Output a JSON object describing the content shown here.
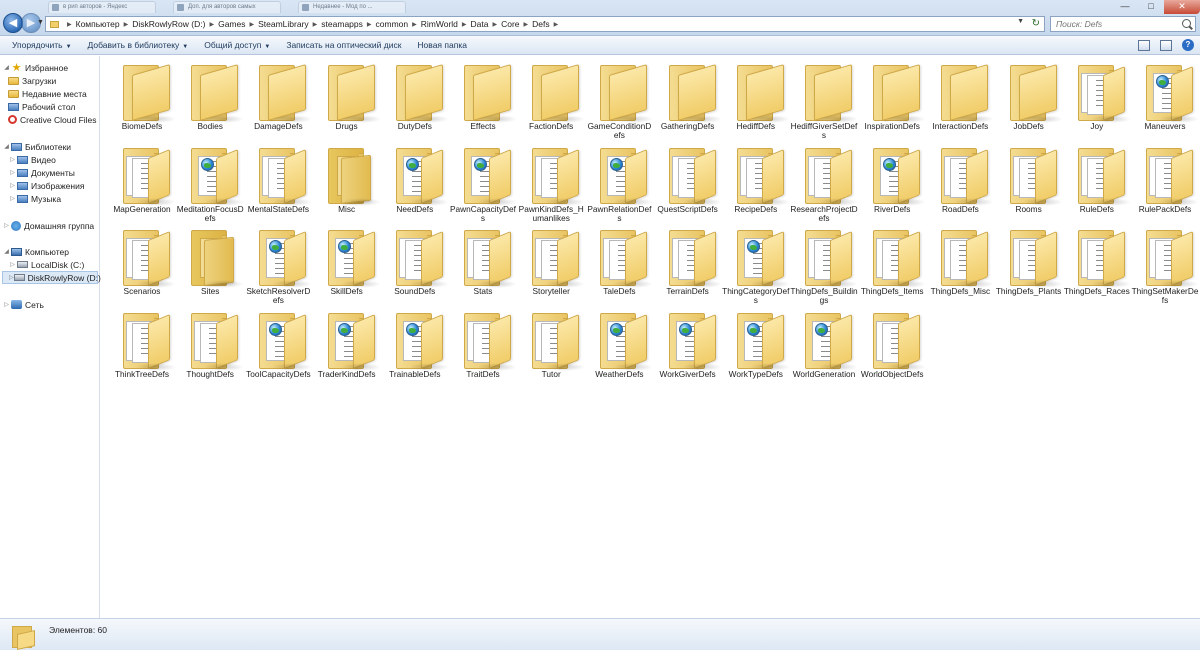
{
  "tabs": [
    {
      "label": "в рип авторов - Яндекс"
    },
    {
      "label": "Доп. для авторов самых"
    },
    {
      "label": "Недавнее - Мод по ..."
    }
  ],
  "breadcrumbs": [
    "Компьютер",
    "DiskRowlyRow (D:)",
    "Games",
    "SteamLibrary",
    "steamapps",
    "common",
    "RimWorld",
    "Data",
    "Core",
    "Defs"
  ],
  "search": {
    "placeholder": "Поиск: Defs"
  },
  "commands": [
    "Упорядочить",
    "Добавить в библиотеку",
    "Общий доступ",
    "Записать на оптический диск",
    "Новая папка"
  ],
  "nav": {
    "favorites": "Избранное",
    "downloads": "Загрузки",
    "recent": "Недавние места",
    "desktop": "Рабочий стол",
    "creative": "Creative Cloud Files",
    "libraries": "Библиотеки",
    "video": "Видео",
    "documents": "Документы",
    "images": "Изображения",
    "music": "Музыка",
    "homegroup": "Домашняя группа",
    "computer": "Компьютер",
    "localc": "LocalDisk (C:)",
    "diskd": "DiskRowlyRow (D:)",
    "network": "Сеть"
  },
  "folders": [
    {
      "name": "BiomeDefs",
      "icon": "empty"
    },
    {
      "name": "Bodies",
      "icon": "empty"
    },
    {
      "name": "DamageDefs",
      "icon": "empty"
    },
    {
      "name": "Drugs",
      "icon": "empty"
    },
    {
      "name": "DutyDefs",
      "icon": "empty"
    },
    {
      "name": "Effects",
      "icon": "empty"
    },
    {
      "name": "FactionDefs",
      "icon": "empty"
    },
    {
      "name": "GameConditionDefs",
      "icon": "empty"
    },
    {
      "name": "GatheringDefs",
      "icon": "empty"
    },
    {
      "name": "HediffDefs",
      "icon": "empty"
    },
    {
      "name": "HediffGiverSetDefs",
      "icon": "empty"
    },
    {
      "name": "InspirationDefs",
      "icon": "empty"
    },
    {
      "name": "InteractionDefs",
      "icon": "empty"
    },
    {
      "name": "JobDefs",
      "icon": "empty"
    },
    {
      "name": "Joy",
      "icon": "papers"
    },
    {
      "name": "Maneuvers",
      "icon": "globe"
    },
    {
      "name": "MapGeneration",
      "icon": "papers"
    },
    {
      "name": "MeditationFocusDefs",
      "icon": "globe"
    },
    {
      "name": "MentalStateDefs",
      "icon": "papers"
    },
    {
      "name": "Misc",
      "icon": "misc"
    },
    {
      "name": "NeedDefs",
      "icon": "globe"
    },
    {
      "name": "PawnCapacityDefs",
      "icon": "globe"
    },
    {
      "name": "PawnKindDefs_Humanlikes",
      "icon": "papers"
    },
    {
      "name": "PawnRelationDefs",
      "icon": "globe"
    },
    {
      "name": "QuestScriptDefs",
      "icon": "papers"
    },
    {
      "name": "RecipeDefs",
      "icon": "papers"
    },
    {
      "name": "ResearchProjectDefs",
      "icon": "papers"
    },
    {
      "name": "RiverDefs",
      "icon": "globe"
    },
    {
      "name": "RoadDefs",
      "icon": "papers"
    },
    {
      "name": "Rooms",
      "icon": "papers"
    },
    {
      "name": "RuleDefs",
      "icon": "papers"
    },
    {
      "name": "RulePackDefs",
      "icon": "papers"
    },
    {
      "name": "Scenarios",
      "icon": "papers"
    },
    {
      "name": "Sites",
      "icon": "misc"
    },
    {
      "name": "SketchResolverDefs",
      "icon": "globe"
    },
    {
      "name": "SkillDefs",
      "icon": "globe"
    },
    {
      "name": "SoundDefs",
      "icon": "papers"
    },
    {
      "name": "Stats",
      "icon": "papers"
    },
    {
      "name": "Storyteller",
      "icon": "papers"
    },
    {
      "name": "TaleDefs",
      "icon": "papers"
    },
    {
      "name": "TerrainDefs",
      "icon": "papers"
    },
    {
      "name": "ThingCategoryDefs",
      "icon": "globe"
    },
    {
      "name": "ThingDefs_Buildings",
      "icon": "papers"
    },
    {
      "name": "ThingDefs_Items",
      "icon": "papers"
    },
    {
      "name": "ThingDefs_Misc",
      "icon": "papers"
    },
    {
      "name": "ThingDefs_Plants",
      "icon": "papers"
    },
    {
      "name": "ThingDefs_Races",
      "icon": "papers"
    },
    {
      "name": "ThingSetMakerDefs",
      "icon": "papers"
    },
    {
      "name": "ThinkTreeDefs",
      "icon": "papers"
    },
    {
      "name": "ThoughtDefs",
      "icon": "papers"
    },
    {
      "name": "ToolCapacityDefs",
      "icon": "globe"
    },
    {
      "name": "TraderKindDefs",
      "icon": "globe"
    },
    {
      "name": "TrainableDefs",
      "icon": "globe"
    },
    {
      "name": "TraitDefs",
      "icon": "papers"
    },
    {
      "name": "Tutor",
      "icon": "papers"
    },
    {
      "name": "WeatherDefs",
      "icon": "globe"
    },
    {
      "name": "WorkGiverDefs",
      "icon": "globe"
    },
    {
      "name": "WorkTypeDefs",
      "icon": "globe"
    },
    {
      "name": "WorldGeneration",
      "icon": "globe"
    },
    {
      "name": "WorldObjectDefs",
      "icon": "papers"
    }
  ],
  "status": {
    "text": "Элементов: 60"
  },
  "colors": {
    "folder": "#f1cd69",
    "selection": "#dbe8f6",
    "titlebar": "#c6d8ec"
  }
}
